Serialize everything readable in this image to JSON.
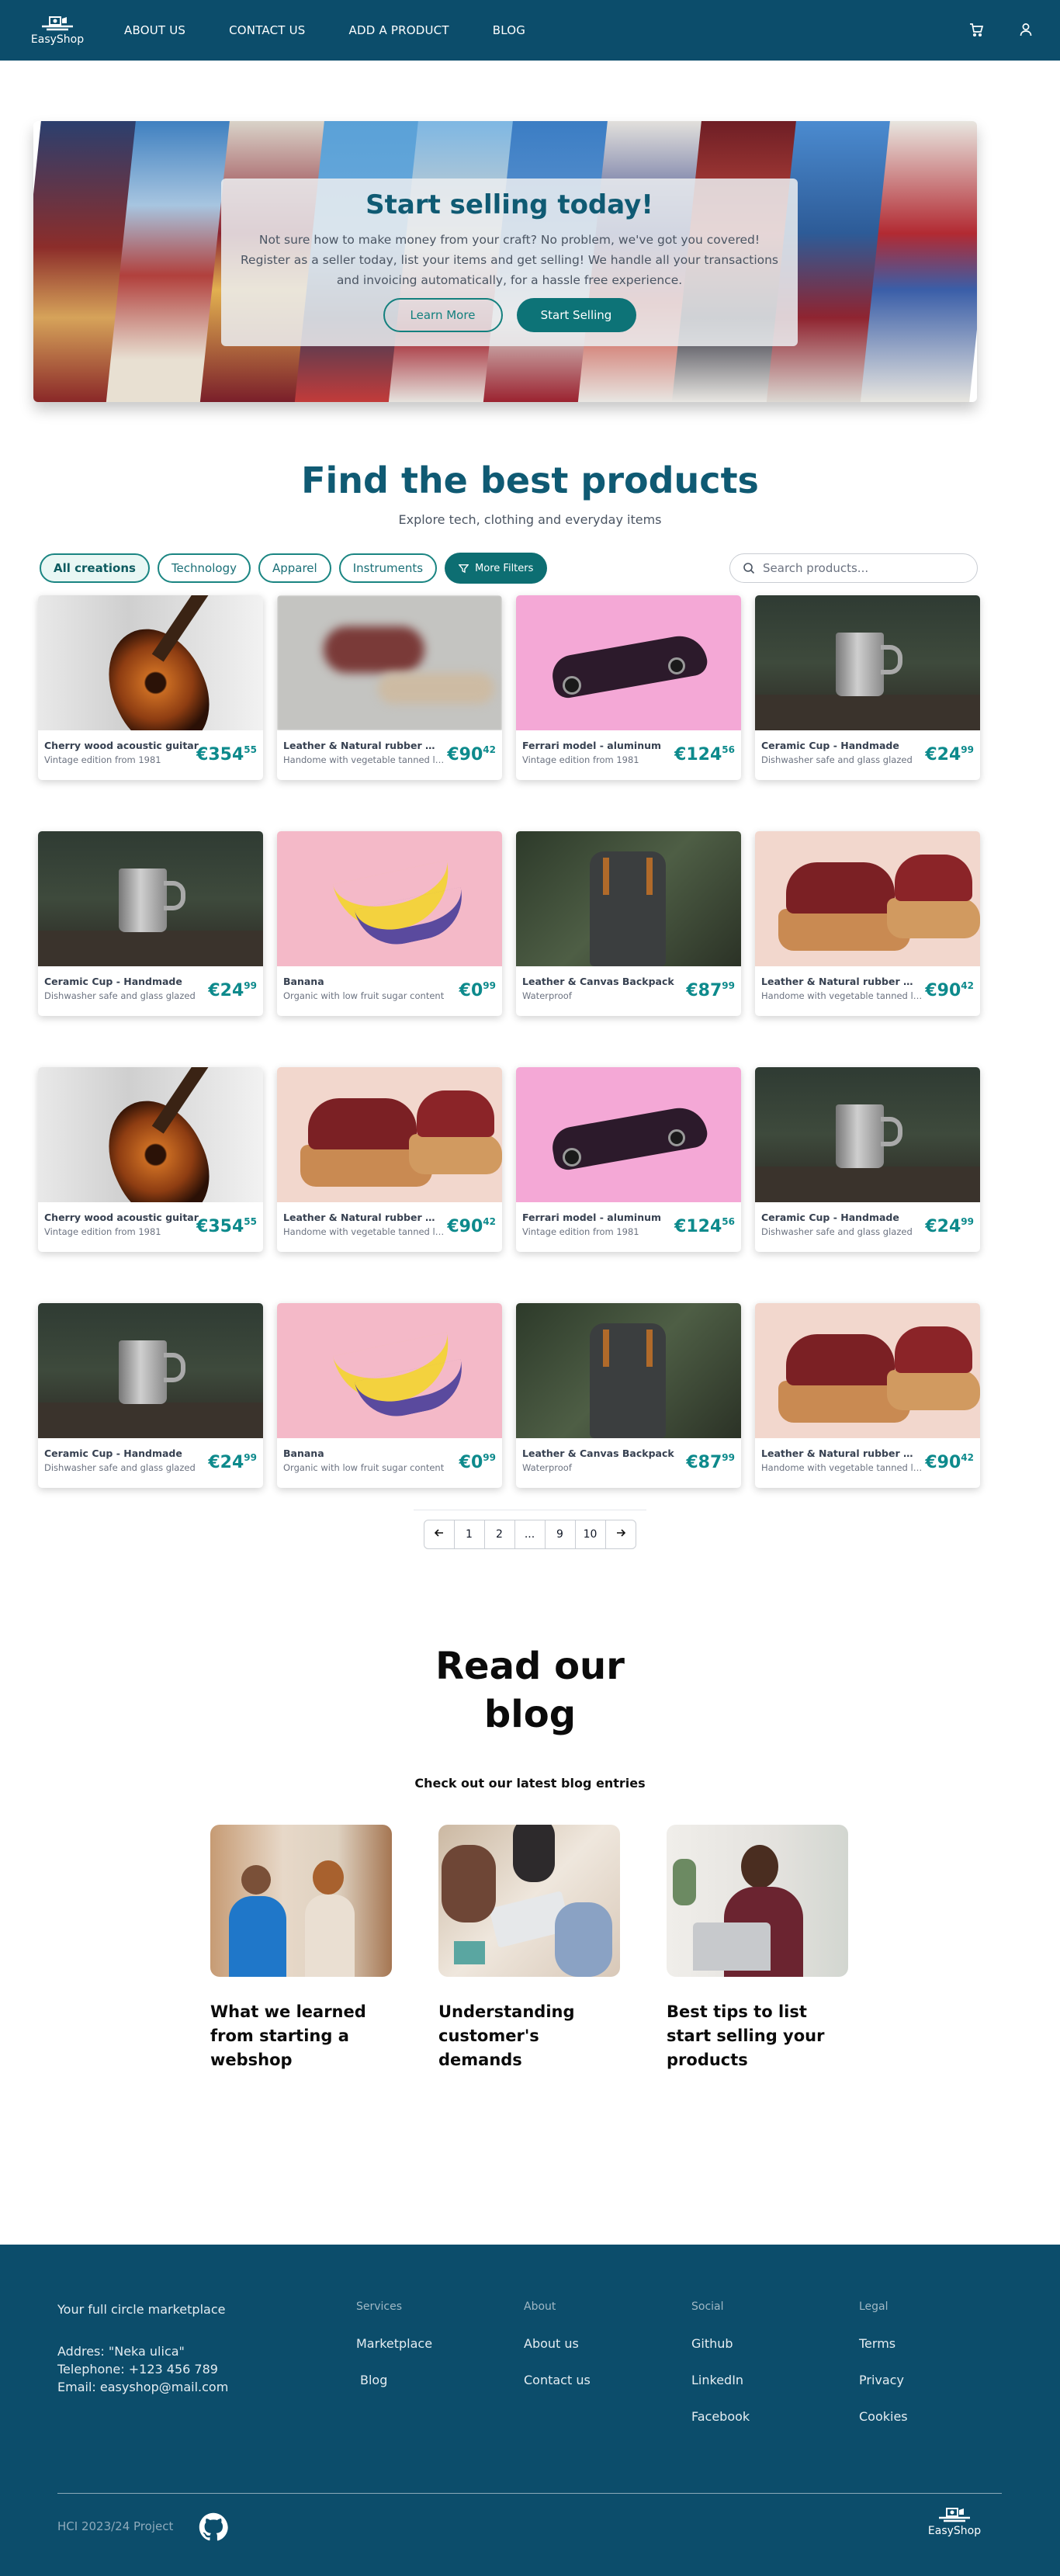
{
  "nav": {
    "logo_text": "EasyShop",
    "links": [
      "ABOUT US",
      "CONTACT US",
      "ADD A PRODUCT",
      "BLOG"
    ],
    "icons": [
      "cart-icon",
      "user-icon"
    ]
  },
  "hero": {
    "title": "Start selling today!",
    "text": "Not sure how to make money from your craft? No problem, we've got you covered! Register as a seller today, list your items and get selling! We handle all your transactions and invoicing automatically, for a hassle free experience.",
    "learn_more": "Learn More",
    "start_selling": "Start Selling"
  },
  "products": {
    "title": "Find the best products",
    "subtitle": "Explore tech, clothing  and everyday items",
    "filters": [
      "All creations",
      "Technology",
      "Apparel",
      "Instruments"
    ],
    "active_filter": "All creations",
    "more_filters": "More Filters",
    "search_placeholder": "Search products...",
    "items": [
      {
        "name": "Cherry wood acoustic guitar",
        "desc": "Vintage edition from 1981",
        "price_main": "€354",
        "price_cents": "55",
        "image": "guitar"
      },
      {
        "name": "Leather & Natural rubber sandals",
        "desc": "Handome with vegetable tanned leather",
        "price_main": "€90",
        "price_cents": "42",
        "image": "sandals-blurred"
      },
      {
        "name": "Ferrari model - aluminum",
        "desc": "Vintage edition from 1981",
        "price_main": "€124",
        "price_cents": "56",
        "image": "car"
      },
      {
        "name": "Ceramic Cup - Handmade",
        "desc": "Dishwasher safe and glass glazed",
        "price_main": "€24",
        "price_cents": "99",
        "image": "cup"
      },
      {
        "name": "Ceramic Cup - Handmade",
        "desc": "Dishwasher safe and glass glazed",
        "price_main": "€24",
        "price_cents": "99",
        "image": "cup"
      },
      {
        "name": "Banana",
        "desc": "Organic with low fruit sugar content",
        "price_main": "€0",
        "price_cents": "99",
        "image": "banana"
      },
      {
        "name": "Leather & Canvas Backpack",
        "desc": "Waterproof",
        "price_main": "€87",
        "price_cents": "99",
        "image": "backpack"
      },
      {
        "name": "Leather & Natural rubber sandals",
        "desc": "Handome with vegetable tanned leather",
        "price_main": "€90",
        "price_cents": "42",
        "image": "sandals"
      },
      {
        "name": "Cherry wood acoustic guitar",
        "desc": "Vintage edition from 1981",
        "price_main": "€354",
        "price_cents": "55",
        "image": "guitar"
      },
      {
        "name": "Leather & Natural rubber sandals",
        "desc": "Handome with vegetable tanned leather",
        "price_main": "€90",
        "price_cents": "42",
        "image": "sandals"
      },
      {
        "name": "Ferrari model - aluminum",
        "desc": "Vintage edition from 1981",
        "price_main": "€124",
        "price_cents": "56",
        "image": "car"
      },
      {
        "name": "Ceramic Cup - Handmade",
        "desc": "Dishwasher safe and glass glazed",
        "price_main": "€24",
        "price_cents": "99",
        "image": "cup"
      },
      {
        "name": "Ceramic Cup - Handmade",
        "desc": "Dishwasher safe and glass glazed",
        "price_main": "€24",
        "price_cents": "99",
        "image": "cup"
      },
      {
        "name": "Banana",
        "desc": "Organic with low fruit sugar content",
        "price_main": "€0",
        "price_cents": "99",
        "image": "banana"
      },
      {
        "name": "Leather & Canvas Backpack",
        "desc": "Waterproof",
        "price_main": "€87",
        "price_cents": "99",
        "image": "backpack"
      },
      {
        "name": "Leather & Natural rubber sandals",
        "desc": "Handome with vegetable tanned leather",
        "price_main": "€90",
        "price_cents": "42",
        "image": "sandals"
      }
    ]
  },
  "pagination": {
    "prev_icon": "arrow-left-icon",
    "pages": [
      "1",
      "2",
      "...",
      "9",
      "10"
    ],
    "next_icon": "arrow-right-icon"
  },
  "blog": {
    "title_line1": "Read our",
    "title_line2": "blog",
    "subtitle": "Check out our latest blog entries",
    "posts": [
      {
        "title": "What we learned from starting a webshop",
        "image": "two-people-tablet"
      },
      {
        "title": "Understanding customer's demands",
        "image": "team-laptop"
      },
      {
        "title": "Best tips to list start selling your products",
        "image": "man-laptop"
      }
    ]
  },
  "footer": {
    "tagline": "Your full circle marketplace",
    "address": "Addres: \"Neka ulica\"",
    "telephone": "Telephone: +123 456 789",
    "email": "Email: easyshop@mail.com",
    "columns": [
      {
        "heading": "Services",
        "links": [
          "Marketplace",
          "Blog"
        ]
      },
      {
        "heading": "About",
        "links": [
          "About us",
          "Contact us"
        ]
      },
      {
        "heading": "Social",
        "links": [
          "Github",
          "LinkedIn",
          "Facebook"
        ]
      },
      {
        "heading": "Legal",
        "links": [
          "Terms",
          "Privacy",
          "Cookies"
        ]
      }
    ],
    "copyright": "HCI 2023/24 Project",
    "github_icon": "github-icon",
    "logo_text": "EasyShop"
  },
  "colors": {
    "navy": "#0c4d6b",
    "teal": "#0d7377",
    "price": "#0d8a8c"
  }
}
